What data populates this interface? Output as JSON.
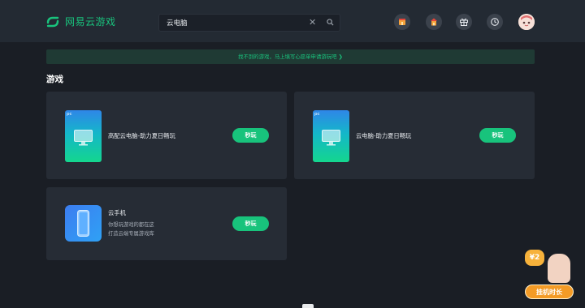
{
  "header": {
    "logo_text": "网易云游戏",
    "search": {
      "value": "云电脑",
      "clear_symbol": "✕"
    },
    "nav_icons": [
      "shop-icon",
      "store-icon",
      "gift-icon",
      "history-clock-icon",
      "user-avatar"
    ]
  },
  "notice": {
    "text": "找不到的游戏，马上填写心愿单申请游玩吧 ❯"
  },
  "section": {
    "title": "游戏"
  },
  "cards": [
    {
      "badge": "pc",
      "title": "高配云电脑-助力夏日畅玩",
      "button": "秒玩"
    },
    {
      "badge": "pc",
      "title": "云电脑-助力夏日畅玩",
      "button": "秒玩"
    },
    {
      "title": "云手机",
      "desc_line1": "你想玩游戏的都在这",
      "desc_line2": "打造云端专属游戏库",
      "button": "秒玩"
    }
  ],
  "promo": {
    "badge": "¥2",
    "label": "挂机时长"
  },
  "colors": {
    "accent": "#18c37c",
    "background": "#1a1e25",
    "card": "#262c35",
    "header": "#232a33"
  }
}
